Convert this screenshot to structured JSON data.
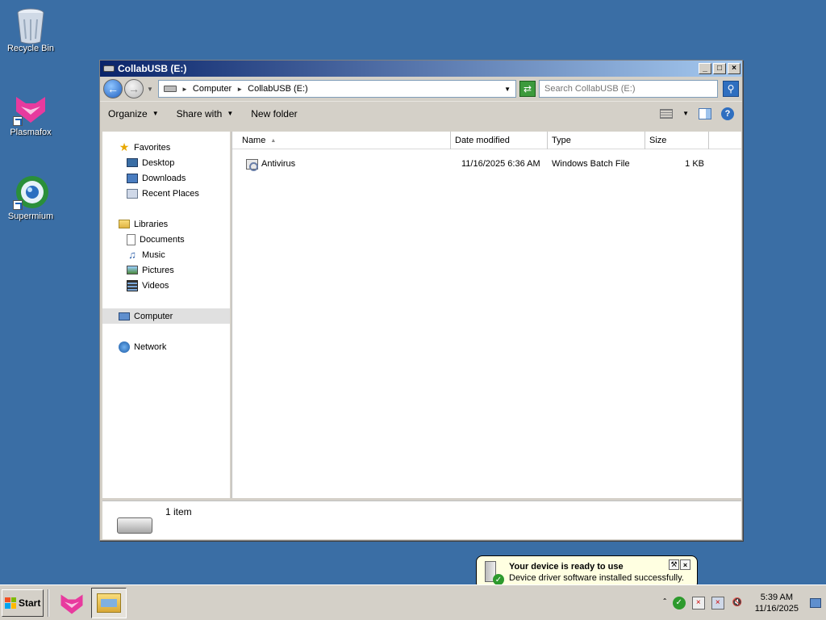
{
  "desktop": {
    "icons": [
      {
        "label": "Recycle Bin",
        "icon": "recycle-bin-icon"
      },
      {
        "label": "Plasmafox",
        "icon": "plasmafox-icon"
      },
      {
        "label": "Supermium",
        "icon": "supermium-icon"
      }
    ]
  },
  "window": {
    "title": "CollabUSB (E:)",
    "controls": {
      "minimize": "_",
      "maximize": "□",
      "close": "×"
    }
  },
  "address": {
    "breadcrumb": [
      "Computer",
      "CollabUSB (E:)"
    ],
    "search_placeholder": "Search CollabUSB (E:)"
  },
  "toolbar": {
    "organize": "Organize",
    "share_with": "Share with",
    "new_folder": "New folder"
  },
  "nav": {
    "favorites": "Favorites",
    "favorites_items": [
      "Desktop",
      "Downloads",
      "Recent Places"
    ],
    "libraries": "Libraries",
    "libraries_items": [
      "Documents",
      "Music",
      "Pictures",
      "Videos"
    ],
    "computer": "Computer",
    "network": "Network"
  },
  "columns": {
    "name": "Name",
    "date": "Date modified",
    "type": "Type",
    "size": "Size"
  },
  "files": [
    {
      "name": "Antivirus",
      "date": "11/16/2025 6:36 AM",
      "type": "Windows Batch File",
      "size": "1 KB"
    }
  ],
  "details": {
    "count": "1 item"
  },
  "balloon": {
    "title": "Your device is ready to use",
    "message": "Device driver software installed successfully."
  },
  "taskbar": {
    "start": "Start",
    "clock_time": "5:39 AM",
    "clock_date": "11/16/2025"
  },
  "colors": {
    "desktop": "#3a6ea5",
    "title_start": "#0a246a",
    "title_end": "#a6caf0",
    "balloon": "#ffffe1"
  }
}
